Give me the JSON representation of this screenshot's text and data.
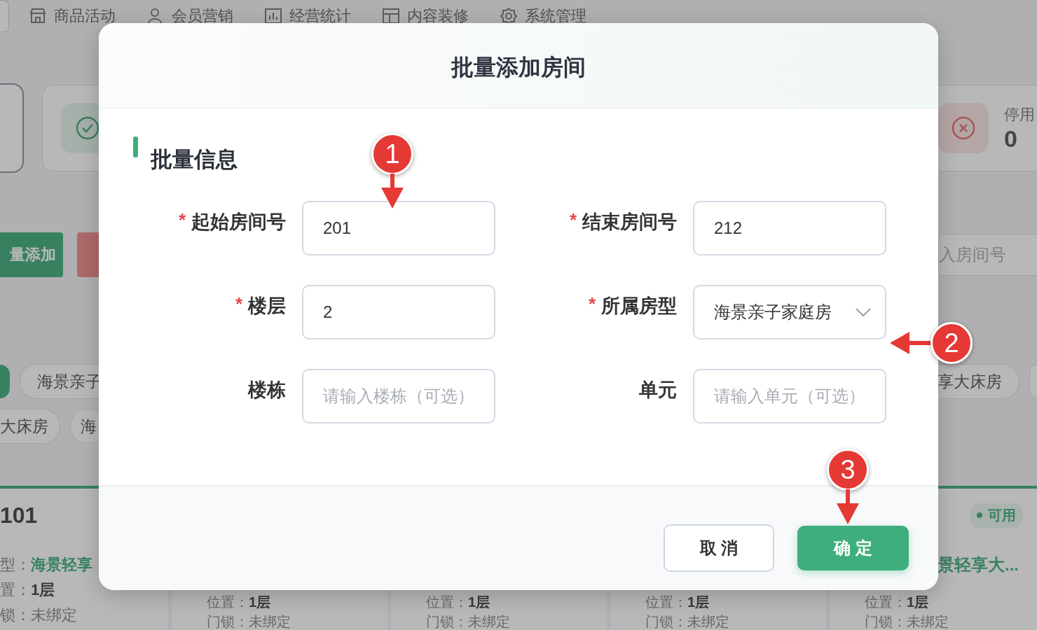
{
  "background": {
    "nav": [
      "商品活动",
      "会员营销",
      "经营统计",
      "内容装修",
      "系统管理"
    ],
    "stat_card": {
      "label": "停用",
      "value": "0"
    },
    "toolbar": {
      "primary_button": "量添加",
      "search_placeholder": "入房间号"
    },
    "tag_rows": [
      {
        "left": [
          "海景亲子"
        ],
        "right": [
          "享大床房"
        ]
      },
      {
        "left": [
          "大床房",
          "海"
        ],
        "right": []
      }
    ],
    "room_cards": [
      {
        "number": "101",
        "fields": [
          {
            "label": "型：",
            "value": "海景轻享",
            "kind": "type"
          },
          {
            "label": "置：",
            "value": "1层",
            "kind": "plain"
          },
          {
            "label": "锁：",
            "value": "未绑定",
            "kind": "muted"
          }
        ]
      },
      {
        "fields": [
          {
            "label": "位置：",
            "value": "1层",
            "kind": "plain"
          },
          {
            "label": "门锁：",
            "value": "未绑定",
            "kind": "muted"
          }
        ]
      },
      {
        "fields": [
          {
            "label": "位置：",
            "value": "1层",
            "kind": "plain"
          },
          {
            "label": "门锁：",
            "value": "未绑定",
            "kind": "muted"
          }
        ]
      },
      {
        "fields": [
          {
            "label": "位置：",
            "value": "1层",
            "kind": "plain"
          },
          {
            "label": "门锁：",
            "value": "未绑定",
            "kind": "muted"
          }
        ]
      },
      {
        "status": "可用",
        "type_value": "景轻享大...",
        "fields": [
          {
            "label": "位置：",
            "value": "1层",
            "kind": "plain"
          },
          {
            "label": "门锁：",
            "value": "未绑定",
            "kind": "muted"
          }
        ]
      }
    ]
  },
  "dialog": {
    "title": "批量添加房间",
    "section_title": "批量信息",
    "fields": [
      {
        "label": "起始房间号",
        "required_mark": "*",
        "kind": "text",
        "value": "201"
      },
      {
        "label": "结束房间号",
        "required_mark": "*",
        "kind": "text",
        "value": "212"
      },
      {
        "label": "楼层",
        "required_mark": "*",
        "kind": "text",
        "value": "2"
      },
      {
        "label": "所属房型",
        "required_mark": "*",
        "kind": "select",
        "value": "海景亲子家庭房"
      },
      {
        "label": "楼栋",
        "kind": "text",
        "placeholder": "请输入楼栋（可选）"
      },
      {
        "label": "单元",
        "kind": "text",
        "placeholder": "请输入单元（可选）"
      }
    ],
    "buttons": [
      {
        "label": "取 消",
        "kind": "secondary"
      },
      {
        "label": "确 定",
        "kind": "primary"
      }
    ]
  },
  "annotations": [
    {
      "number": "1"
    },
    {
      "number": "2"
    },
    {
      "number": "3"
    }
  ]
}
